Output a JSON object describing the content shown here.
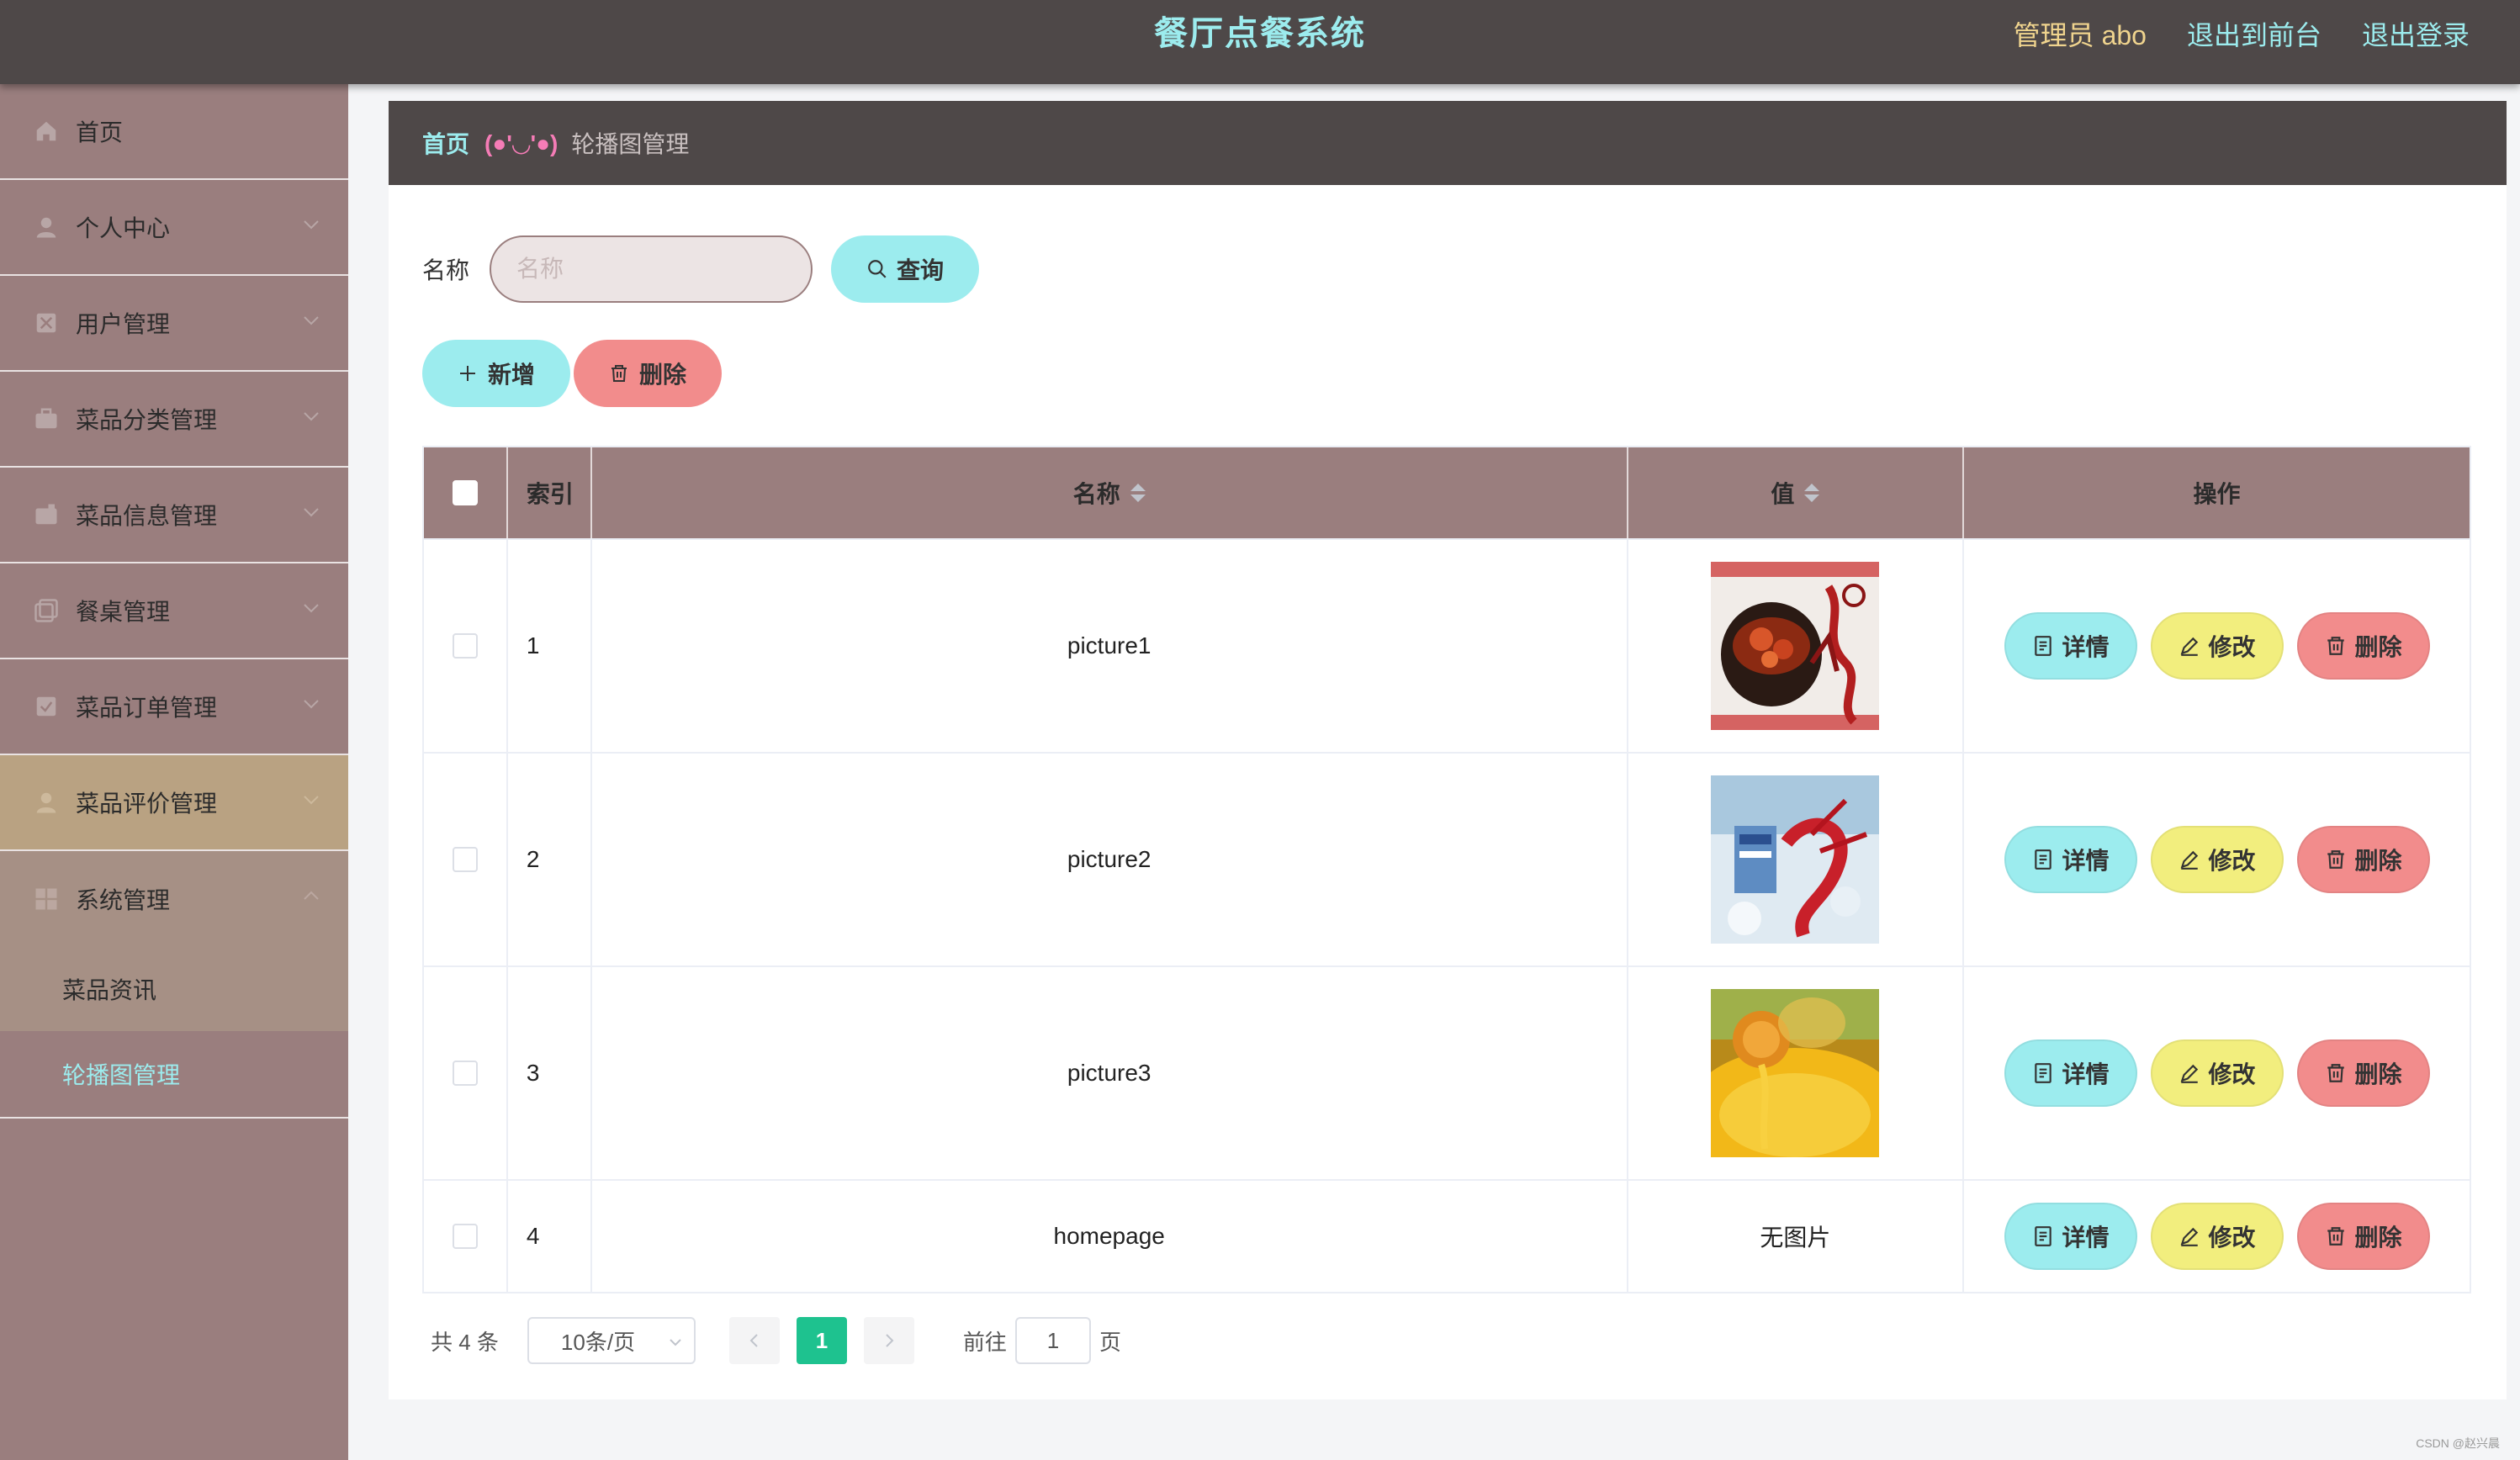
{
  "header": {
    "title": "餐厅点餐系统",
    "user": "管理员 abo",
    "to_front": "退出到前台",
    "logout": "退出登录"
  },
  "sidebar": {
    "items": [
      {
        "label": "首页",
        "icon": "home-icon"
      },
      {
        "label": "个人中心",
        "icon": "user-icon"
      },
      {
        "label": "用户管理",
        "icon": "users-icon"
      },
      {
        "label": "菜品分类管理",
        "icon": "briefcase-icon"
      },
      {
        "label": "菜品信息管理",
        "icon": "card-icon"
      },
      {
        "label": "餐桌管理",
        "icon": "copy-icon"
      },
      {
        "label": "菜品订单管理",
        "icon": "checklist-icon"
      },
      {
        "label": "菜品评价管理",
        "icon": "user-icon"
      },
      {
        "label": "系统管理",
        "icon": "grid-icon"
      }
    ],
    "submenu": [
      "菜品资讯",
      "轮播图管理"
    ]
  },
  "breadcrumb": {
    "home": "首页",
    "emoji": "(●'◡'●)",
    "current": "轮播图管理"
  },
  "search": {
    "label": "名称",
    "placeholder": "名称",
    "button": "查询"
  },
  "actions": {
    "add": "新增",
    "delete": "删除"
  },
  "table": {
    "headers": [
      "索引",
      "名称",
      "值",
      "操作"
    ],
    "rows": [
      {
        "index": "1",
        "name": "picture1",
        "value": "",
        "image": "crayfish-bowl"
      },
      {
        "index": "2",
        "name": "picture2",
        "value": "",
        "image": "crayfish-ice"
      },
      {
        "index": "3",
        "name": "picture3",
        "value": "",
        "image": "dessert-yellow"
      },
      {
        "index": "4",
        "name": "homepage",
        "value": "无图片",
        "image": ""
      }
    ],
    "ops": {
      "detail": "详情",
      "edit": "修改",
      "delete": "删除"
    }
  },
  "pagination": {
    "total": "共 4 条",
    "page_size": "10条/页",
    "current_page": "1",
    "goto_label": "前往",
    "goto_value": "1",
    "page_suffix": "页"
  },
  "watermark": "CSDN @赵兴晨",
  "colors": {
    "header_bg": "#4e4848",
    "accent_cyan": "#9cecee",
    "sidebar_bg": "#9a7e7e",
    "active_menu": "#b9a282",
    "edit_yellow": "#f2ee7e",
    "delete_red": "#f28c8c",
    "pager_green": "#1ec28f"
  }
}
